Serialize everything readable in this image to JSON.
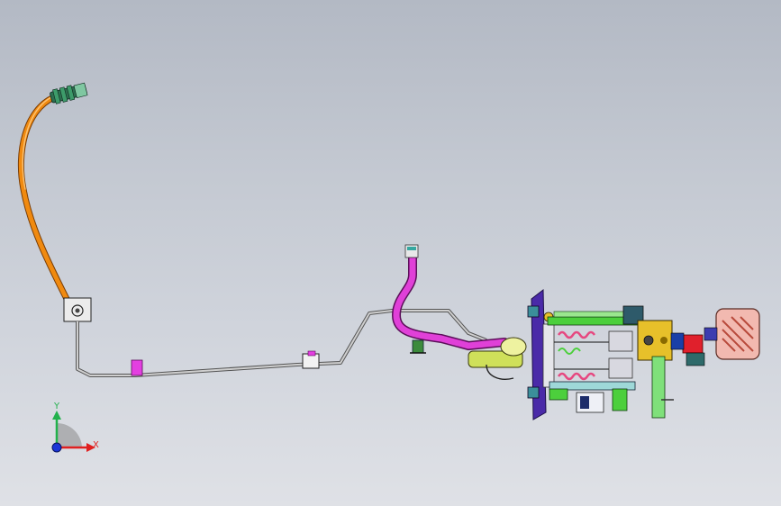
{
  "viewport": {
    "background_top": "#b3b9c4",
    "background_bottom": "#dfe1e6"
  },
  "triad": {
    "y_label": "Y",
    "x_label": "X",
    "y_color": "#22b14c",
    "x_color": "#e02020",
    "z_color": "#1a35d6"
  },
  "parts": {
    "cable_sheath_color": "#f08a10",
    "cable_end_color": "#3d9b6a",
    "tube_color": "#a8a8a8",
    "hose_color": "#e040d8",
    "clip_color": "#e33fe0",
    "pedal_pad_color": "#f2b9b0",
    "pedal_rib_color": "#b84a3c",
    "bracket_green": "#4ccf3c",
    "bracket_yellow": "#e7c02a",
    "flange_purple": "#4a2aa8",
    "cylinder_color": "#d8d8e0",
    "spring_color": "#e64880",
    "red_block": "#e0202c",
    "dark_teal": "#2e6a6a"
  }
}
